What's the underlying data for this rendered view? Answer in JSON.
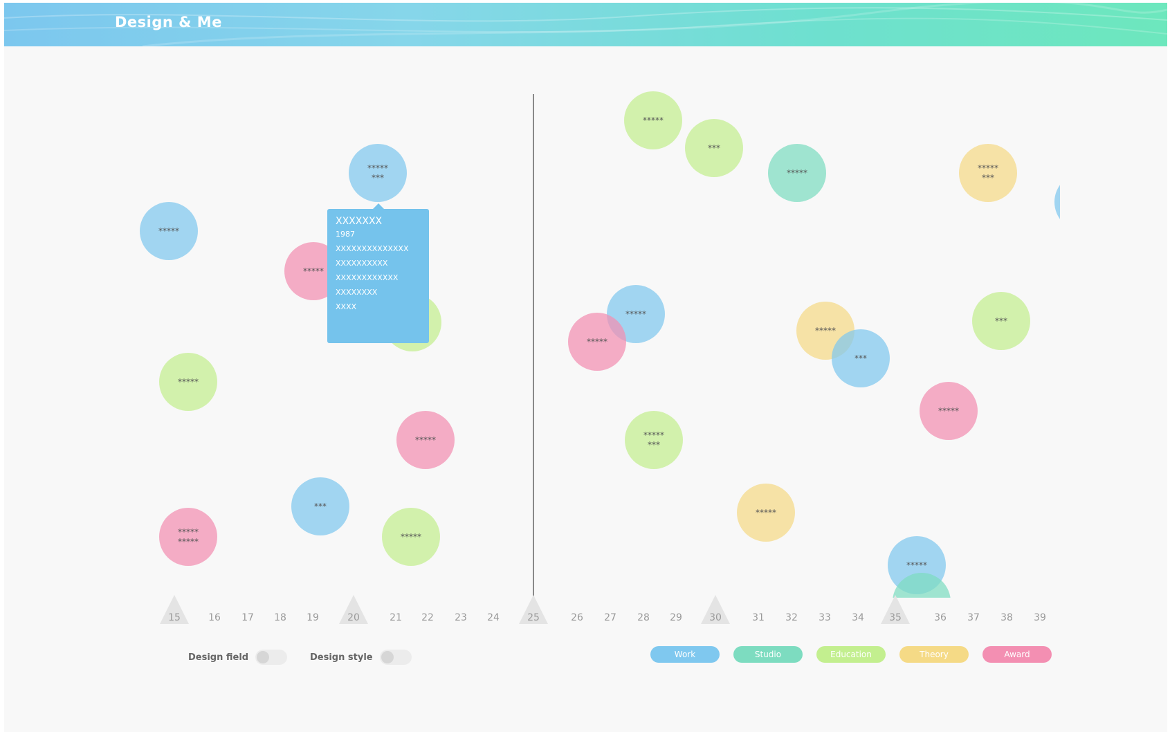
{
  "app": {
    "title": "Design & Me"
  },
  "colors": {
    "work": "#7fc8ef",
    "studio": "#7ddcc0",
    "education": "#c3ef8f",
    "theory": "#f5da86",
    "award": "#f38fb2"
  },
  "axis": {
    "ticks": [
      "15",
      "16",
      "17",
      "18",
      "19",
      "20",
      "21",
      "22",
      "23",
      "24",
      "25",
      "26",
      "27",
      "28",
      "29",
      "30",
      "31",
      "32",
      "33",
      "34",
      "35",
      "36",
      "37",
      "38",
      "39"
    ],
    "highlighted_ticks": [
      "15",
      "20",
      "25",
      "30",
      "35"
    ]
  },
  "bubbles": [
    {
      "category": "work",
      "lines": [
        "*****"
      ]
    },
    {
      "category": "work",
      "lines": [
        "*****",
        "***"
      ]
    },
    {
      "category": "award",
      "lines": [
        "*****"
      ]
    },
    {
      "category": "education",
      "lines": [
        "***"
      ]
    },
    {
      "category": "education",
      "lines": [
        "*****"
      ]
    },
    {
      "category": "award",
      "lines": [
        "*****"
      ]
    },
    {
      "category": "work",
      "lines": [
        "***"
      ]
    },
    {
      "category": "award",
      "lines": [
        "*****",
        "*****"
      ]
    },
    {
      "category": "education",
      "lines": [
        "*****"
      ]
    },
    {
      "category": "education",
      "lines": [
        "*****"
      ]
    },
    {
      "category": "education",
      "lines": [
        "***"
      ]
    },
    {
      "category": "studio",
      "lines": [
        "*****"
      ]
    },
    {
      "category": "theory",
      "lines": [
        "*****",
        "***"
      ]
    },
    {
      "category": "work",
      "lines": []
    },
    {
      "category": "work",
      "lines": [
        "*****"
      ]
    },
    {
      "category": "award",
      "lines": [
        "*****"
      ]
    },
    {
      "category": "theory",
      "lines": [
        "*****"
      ]
    },
    {
      "category": "work",
      "lines": [
        "***"
      ]
    },
    {
      "category": "education",
      "lines": [
        "***"
      ]
    },
    {
      "category": "award",
      "lines": [
        "*****"
      ]
    },
    {
      "category": "education",
      "lines": [
        "*****",
        "***"
      ]
    },
    {
      "category": "theory",
      "lines": [
        "*****"
      ]
    },
    {
      "category": "work",
      "lines": [
        "*****"
      ]
    },
    {
      "category": "studio",
      "lines": []
    }
  ],
  "tooltip": {
    "title": "XXXXXXX",
    "year": "1987",
    "lines": [
      "XXXXXXXXXXXXXX",
      "XXXXXXXXXX",
      "XXXXXXXXXXXX",
      "XXXXXXXX",
      "XXXX"
    ]
  },
  "toggles": [
    {
      "label": "Design field",
      "on": false
    },
    {
      "label": "Design style",
      "on": false
    }
  ],
  "legend": [
    {
      "label": "Work",
      "category": "work"
    },
    {
      "label": "Studio",
      "category": "studio"
    },
    {
      "label": "Education",
      "category": "education"
    },
    {
      "label": "Theory",
      "category": "theory"
    },
    {
      "label": "Award",
      "category": "award"
    }
  ]
}
